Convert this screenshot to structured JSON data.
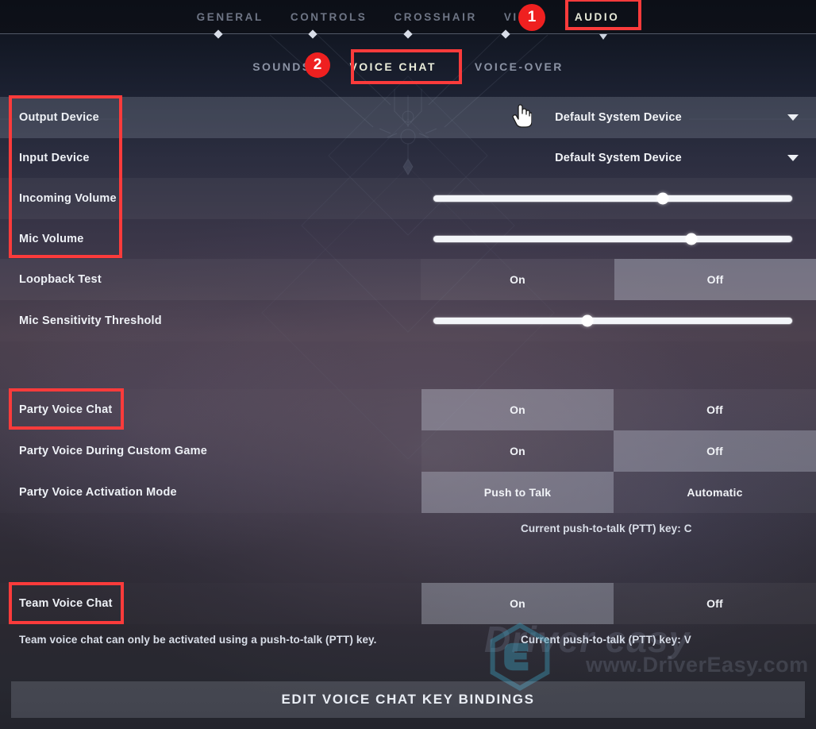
{
  "topnav": {
    "items": [
      {
        "label": "GENERAL",
        "active": false
      },
      {
        "label": "CONTROLS",
        "active": false
      },
      {
        "label": "CROSSHAIR",
        "active": false
      },
      {
        "label": "VIDEO",
        "active": false
      },
      {
        "label": "AUDIO",
        "active": true
      }
    ]
  },
  "subnav": {
    "items": [
      {
        "label": "SOUNDS",
        "active": false
      },
      {
        "label": "VOICE CHAT",
        "active": true
      },
      {
        "label": "VOICE-OVER",
        "active": false
      }
    ]
  },
  "settings": {
    "output_device": {
      "label": "Output Device",
      "value": "Default System Device",
      "caret_icon": "chevron-down-icon"
    },
    "input_device": {
      "label": "Input Device",
      "value": "Default System Device",
      "caret_icon": "chevron-down-icon"
    },
    "incoming_volume": {
      "label": "Incoming Volume",
      "value_percent": 64
    },
    "mic_volume": {
      "label": "Mic Volume",
      "value_percent": 72
    },
    "loopback_test": {
      "label": "Loopback Test",
      "on_label": "On",
      "off_label": "Off",
      "selected": "Off"
    },
    "mic_sensitivity_threshold": {
      "label": "Mic Sensitivity Threshold",
      "value_percent": 43
    },
    "party_voice_chat": {
      "label": "Party Voice Chat",
      "on_label": "On",
      "off_label": "Off",
      "selected": "On"
    },
    "party_voice_custom_game": {
      "label": "Party Voice During Custom Game",
      "on_label": "On",
      "off_label": "Off",
      "selected": "Off"
    },
    "party_voice_activation_mode": {
      "label": "Party Voice Activation Mode",
      "option_a_label": "Push to Talk",
      "option_b_label": "Automatic",
      "selected": "Push to Talk"
    },
    "party_ptt_hint": "Current push-to-talk (PTT) key: C",
    "team_voice_chat": {
      "label": "Team Voice Chat",
      "on_label": "On",
      "off_label": "Off",
      "selected": "On"
    },
    "team_voice_note": "Team voice chat can only be activated using a push-to-talk (PTT) key.",
    "team_ptt_hint": "Current push-to-talk (PTT) key: V"
  },
  "footer": {
    "edit_bindings_label": "EDIT VOICE CHAT KEY BINDINGS"
  },
  "annotations": {
    "badge_1": "1",
    "badge_2": "2"
  },
  "watermark": {
    "brand": "Driver easy",
    "url": "www.DriverEasy.com"
  },
  "colors": {
    "annotation_red": "#fb3b3b",
    "badge_red": "#ef2020",
    "active_text": "#e6e9d8",
    "inactive_text": "#6e7585"
  }
}
